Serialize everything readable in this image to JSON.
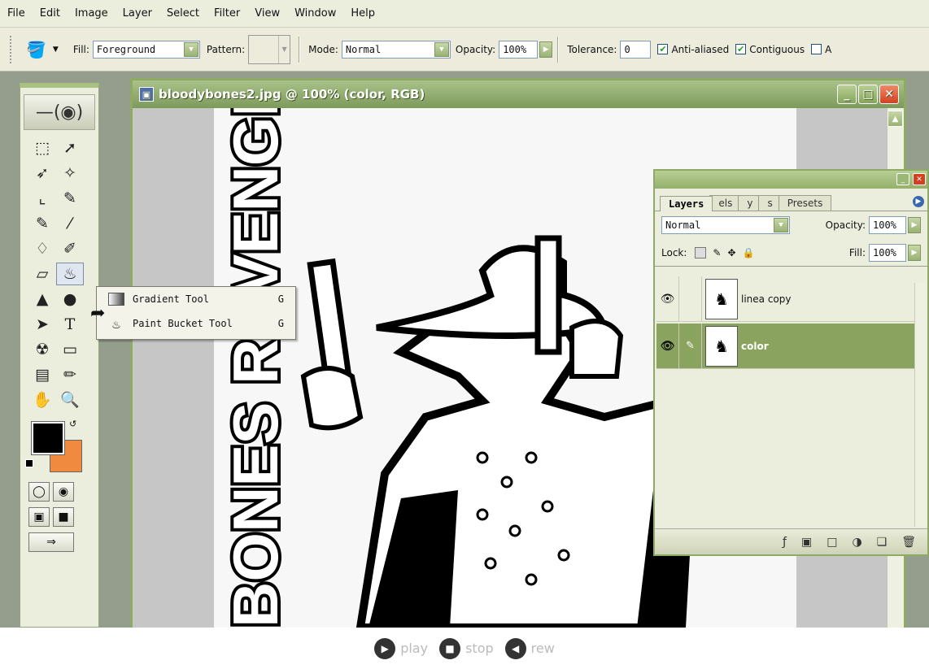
{
  "menu": [
    "File",
    "Edit",
    "Image",
    "Layer",
    "Select",
    "Filter",
    "View",
    "Window",
    "Help"
  ],
  "options": {
    "fill_label": "Fill:",
    "fill_value": "Foreground",
    "pattern_label": "Pattern:",
    "mode_label": "Mode:",
    "mode_value": "Normal",
    "opacity_label": "Opacity:",
    "opacity_value": "100%",
    "tolerance_label": "Tolerance:",
    "tolerance_value": "0",
    "antialiased_label": "Anti-aliased",
    "contiguous_label": "Contiguous",
    "all_layers_label": "A"
  },
  "document": {
    "title": "bloodybones2.jpg @ 100% (color, RGB)",
    "artwork_text": "BONES REVENGE HEAD"
  },
  "flyout": [
    {
      "label": "Gradient Tool",
      "shortcut": "G",
      "icon": "gradient-icon"
    },
    {
      "label": "Paint Bucket Tool",
      "shortcut": "G",
      "icon": "paint-bucket-icon"
    }
  ],
  "layers_panel": {
    "tabs": [
      "Layers",
      "els",
      "y",
      "s",
      "Presets"
    ],
    "blend_mode": "Normal",
    "opacity_label": "Opacity:",
    "opacity_value": "100%",
    "lock_label": "Lock:",
    "fill_label": "Fill:",
    "fill_value": "100%",
    "layers": [
      {
        "name": "linea copy",
        "visible": true,
        "selected": false
      },
      {
        "name": "color",
        "visible": true,
        "selected": true
      }
    ]
  },
  "colors": {
    "foreground": "#000000",
    "background": "#f08a3e",
    "accent": "#8aa460"
  },
  "player": {
    "play": "play",
    "stop": "stop",
    "rew": "rew"
  }
}
